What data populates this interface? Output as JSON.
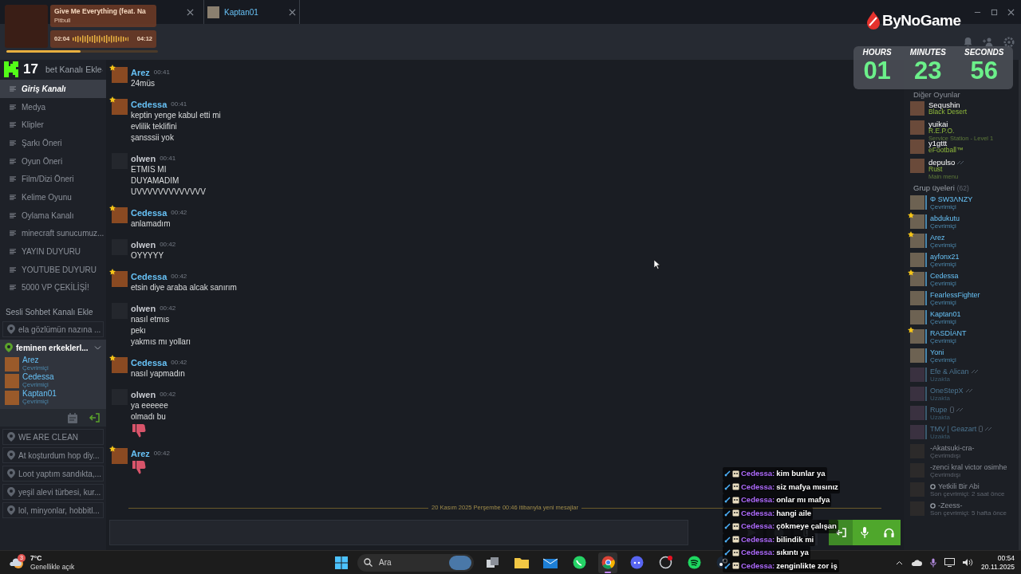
{
  "tabs": [
    {
      "label": "Kaptan01",
      "selected": true
    }
  ],
  "sidebar": {
    "header": "bet Kanalı Ekle",
    "text_channels": [
      {
        "label": "Giriş Kanalı",
        "selected": true
      },
      {
        "label": "Medya",
        "selected": false
      },
      {
        "label": "Klipler",
        "selected": false
      },
      {
        "label": "Şarkı Öneri",
        "selected": false
      },
      {
        "label": "Oyun Öneri",
        "selected": false
      },
      {
        "label": "Film/Dizi Öneri",
        "selected": false
      },
      {
        "label": "Kelime Oyunu",
        "selected": false
      },
      {
        "label": "Oylama Kanalı",
        "selected": false
      },
      {
        "label": "minecraft sunucumuz...",
        "selected": false
      },
      {
        "label": "YAYIN DUYURU",
        "selected": false
      },
      {
        "label": "YOUTUBE DUYURU",
        "selected": false
      },
      {
        "label": "5000 VP ÇEKİLİŞİ!",
        "selected": false
      }
    ],
    "voice_header": "Sesli Sohbet Kanalı Ekle",
    "voice_channels": [
      {
        "label": "ela gözlümün nazına ...",
        "selected": false
      },
      {
        "label": "feminen erkeklerl...",
        "selected": true,
        "expanded": true,
        "members": [
          {
            "name": "Arez",
            "status": "Çevrimiçi"
          },
          {
            "name": "Cedessa",
            "status": "Çevrimiçi"
          },
          {
            "name": "Kaptan01",
            "status": "Çevrimiçi"
          }
        ]
      },
      {
        "label": "WE ARE CLEAN",
        "selected": false
      },
      {
        "label": "At koşturdum hop diy...",
        "selected": false
      },
      {
        "label": "Loot yaptım sandıkta,...",
        "selected": false
      },
      {
        "label": "yeşil alevi türbesi, kur...",
        "selected": false
      },
      {
        "label": "lol, minyonlar, hobbitl...",
        "selected": false
      }
    ]
  },
  "messages": [
    {
      "author": "Arez",
      "time": "00:41",
      "starred": true,
      "color": "#67c1f5",
      "lines": [
        "24müs"
      ],
      "thumbs_down": false
    },
    {
      "author": "Cedessa",
      "time": "00:41",
      "starred": true,
      "color": "#67c1f5",
      "lines": [
        "keptin yenge kabul etti mi",
        "evlilik teklifini",
        "şansssii yok"
      ],
      "thumbs_down": false
    },
    {
      "author": "olwen",
      "time": "00:41",
      "starred": false,
      "color": "#c6c9cf",
      "lines": [
        "ETMIS MI",
        "DUYAMADIM",
        "UVVVVVVVVVVVVV"
      ],
      "thumbs_down": false
    },
    {
      "author": "Cedessa",
      "time": "00:42",
      "starred": true,
      "color": "#67c1f5",
      "lines": [
        "anlamadım"
      ],
      "thumbs_down": false
    },
    {
      "author": "olwen",
      "time": "00:42",
      "starred": false,
      "color": "#c6c9cf",
      "lines": [
        "OYYYYY"
      ],
      "thumbs_down": false
    },
    {
      "author": "Cedessa",
      "time": "00:42",
      "starred": true,
      "color": "#67c1f5",
      "lines": [
        "etsin diye araba alcak sanırım"
      ],
      "thumbs_down": false
    },
    {
      "author": "olwen",
      "time": "00:42",
      "starred": false,
      "color": "#c6c9cf",
      "lines": [
        "nasıl etmıs",
        "pekı",
        "yakmıs mı yolları"
      ],
      "thumbs_down": false
    },
    {
      "author": "Cedessa",
      "time": "00:42",
      "starred": true,
      "color": "#67c1f5",
      "lines": [
        "nasıl yapmadın"
      ],
      "thumbs_down": false
    },
    {
      "author": "olwen",
      "time": "00:42",
      "starred": false,
      "color": "#c6c9cf",
      "lines": [
        "ya eeeeee",
        "olmadı bu"
      ],
      "thumbs_down": true
    },
    {
      "author": "Arez",
      "time": "00:42",
      "starred": true,
      "color": "#67c1f5",
      "thumbs_down": true
    }
  ],
  "new_messages_divider": "20 Kasım 2025 Perşembe 00:46 itibarıyla yeni mesajlar",
  "members_panel": {
    "playing_header": "Diğer Oyunlar",
    "playing": [
      {
        "name": "Sequshin",
        "game": "Black Desert"
      },
      {
        "name": "yuikai",
        "game": "R.E.P.O.",
        "detail": "Service Station - Level 1"
      },
      {
        "name": "y1gttt",
        "game": "eFootball™"
      },
      {
        "name": "depulso",
        "game": "Rust",
        "detail": "Main menu",
        "snooze": true
      }
    ],
    "group_header": "Grup üyeleri",
    "group_count": "(62)",
    "members": [
      {
        "name": "Φ SW3ΛNZY",
        "status": "Çevrimiçi",
        "kind": "online",
        "starred": false
      },
      {
        "name": "abdukutu",
        "status": "Çevrimiçi",
        "kind": "online",
        "starred": true
      },
      {
        "name": "Arez",
        "status": "Çevrimiçi",
        "kind": "online",
        "starred": true
      },
      {
        "name": "ayfonx21",
        "status": "Çevrimiçi",
        "kind": "online",
        "starred": false
      },
      {
        "name": "Cedessa",
        "status": "Çevrimiçi",
        "kind": "online",
        "starred": true
      },
      {
        "name": "FearlessFighter",
        "status": "Çevrimiçi",
        "kind": "online",
        "starred": false
      },
      {
        "name": "Kaptan01",
        "status": "Çevrimiçi",
        "kind": "online",
        "starred": false
      },
      {
        "name": "RASDİANT",
        "status": "Çevrimiçi",
        "kind": "online",
        "starred": true
      },
      {
        "name": "Yoni",
        "status": "Çevrimiçi",
        "kind": "online",
        "starred": false
      },
      {
        "name": "Efe & Alican",
        "status": "Uzakta",
        "kind": "away",
        "starred": false,
        "snooze": true
      },
      {
        "name": "OneStepX",
        "status": "Uzakta",
        "kind": "away",
        "starred": false,
        "snooze": true
      },
      {
        "name": "Rupe",
        "status": "Uzakta",
        "kind": "away",
        "starred": false,
        "phone": true,
        "snooze": true
      },
      {
        "name": "TMV | Geazart",
        "status": "Uzakta",
        "kind": "away",
        "starred": false,
        "phone": true,
        "snooze": true
      },
      {
        "name": "-Akatsuki-cra-",
        "status": "Çevrimdışı",
        "kind": "offline",
        "starred": false
      },
      {
        "name": "-zenci kral victor osimhe",
        "status": "Çevrimdışı",
        "kind": "offline",
        "starred": false
      },
      {
        "name": "Yetkili Bir Abi",
        "status": "Son çevrimiçi: 2 saat önce",
        "kind": "offline",
        "starred": false,
        "prefix_icon": true
      },
      {
        "name": "-Zeess-",
        "status": "Son çevrimiçi: 5 hafta önce",
        "kind": "offline",
        "starred": false,
        "prefix_icon": true
      }
    ]
  },
  "taskbar": {
    "weather": {
      "badge": "3",
      "temp": "7°C",
      "condition": "Genellikle açık"
    },
    "search_placeholder": "Ara",
    "apps": [
      {
        "kind": "taskview",
        "selected": false
      },
      {
        "kind": "folder",
        "selected": false
      },
      {
        "kind": "mail",
        "selected": false
      },
      {
        "kind": "whatsapp",
        "selected": false
      },
      {
        "kind": "chrome",
        "selected": true
      },
      {
        "kind": "discord",
        "selected": false
      },
      {
        "kind": "app",
        "selected": false
      },
      {
        "kind": "spotify",
        "selected": false
      },
      {
        "kind": "steam",
        "selected": false
      }
    ],
    "time": "00:54",
    "date": "20.11.2025"
  },
  "overlays": {
    "now_playing": {
      "title": "Give Me Everything (feat. Na",
      "artist": "Pitbull",
      "elapsed": "02:04",
      "total": "04:12",
      "level": 0.49
    },
    "viewers": "17",
    "logo": "ByNoGame",
    "timer": [
      {
        "label": "HOURS",
        "value": "01"
      },
      {
        "label": "MINUTES",
        "value": "23"
      },
      {
        "label": "SECONDS",
        "value": "56"
      }
    ],
    "chat": [
      {
        "user": "Cedessa:",
        "text": "kim bunlar ya"
      },
      {
        "user": "Cedessa:",
        "text": "siz mafya mısınız"
      },
      {
        "user": "Cedessa:",
        "text": "onlar mı mafya"
      },
      {
        "user": "Cedessa:",
        "text": "hangi aile"
      },
      {
        "user": "Cedessa:",
        "text": "çökmeye çalışan"
      },
      {
        "user": "Cedessa:",
        "text": "bilindik mi"
      },
      {
        "user": "Cedessa:",
        "text": "sıkıntı ya"
      },
      {
        "user": "Cedessa:",
        "text": "zenginlikte zor iş"
      }
    ]
  }
}
